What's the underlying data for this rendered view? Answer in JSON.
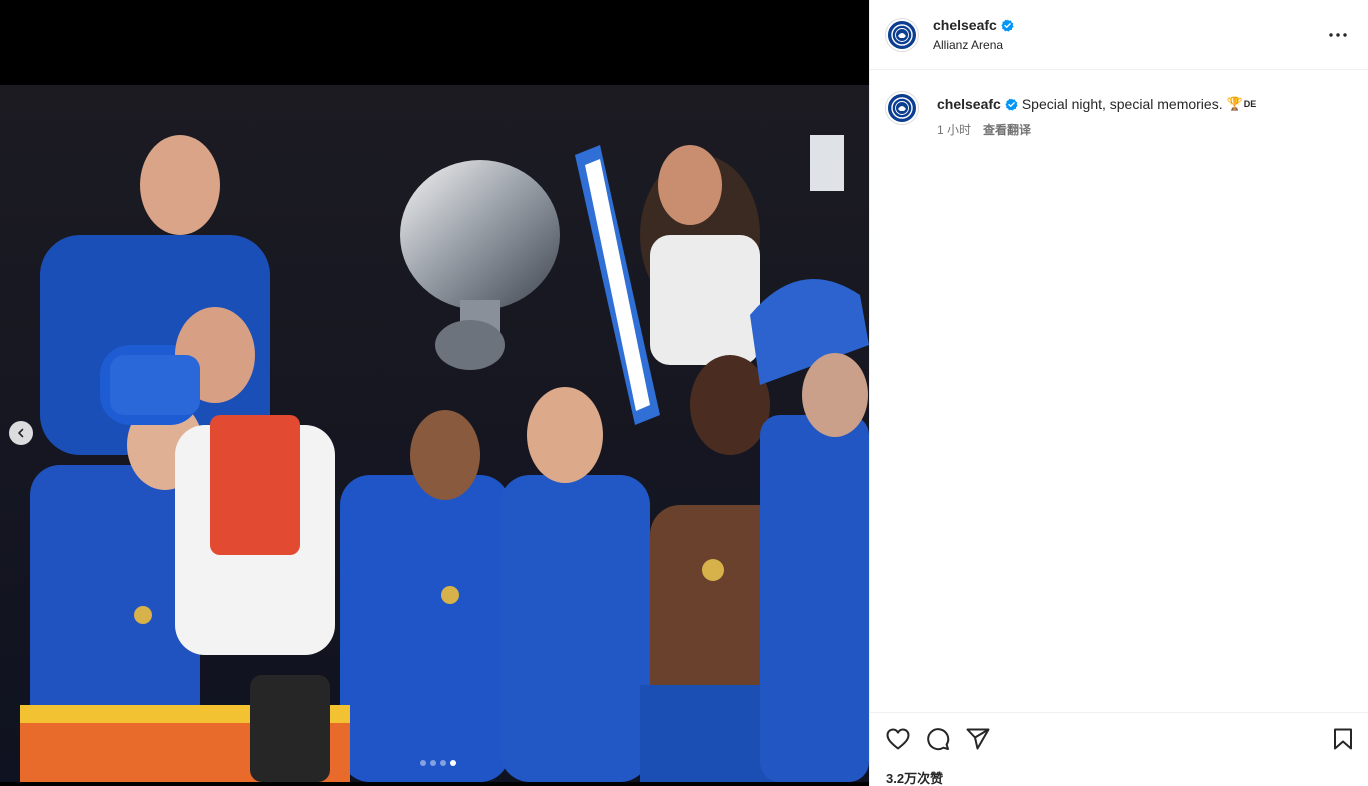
{
  "post": {
    "username": "chelseafc",
    "location": "Allianz Arena",
    "caption": "Special night, special memories.",
    "caption_emoji": "🏆",
    "caption_extra": "DE",
    "time": "1 小时",
    "translate_label": "查看翻译",
    "likes": "3.2万次赞"
  },
  "carousel": {
    "slide_count": 4,
    "active_index": 3
  },
  "icons": {
    "verified": "verified-badge-icon",
    "more": "more-options-icon",
    "like": "heart-icon",
    "comment": "comment-bubble-icon",
    "share": "paper-plane-icon",
    "save": "bookmark-icon",
    "prev": "chevron-left-icon"
  },
  "colors": {
    "verified": "#0095f6",
    "club_blue": "#0b3d91",
    "text": "#262626",
    "muted": "#737373"
  }
}
